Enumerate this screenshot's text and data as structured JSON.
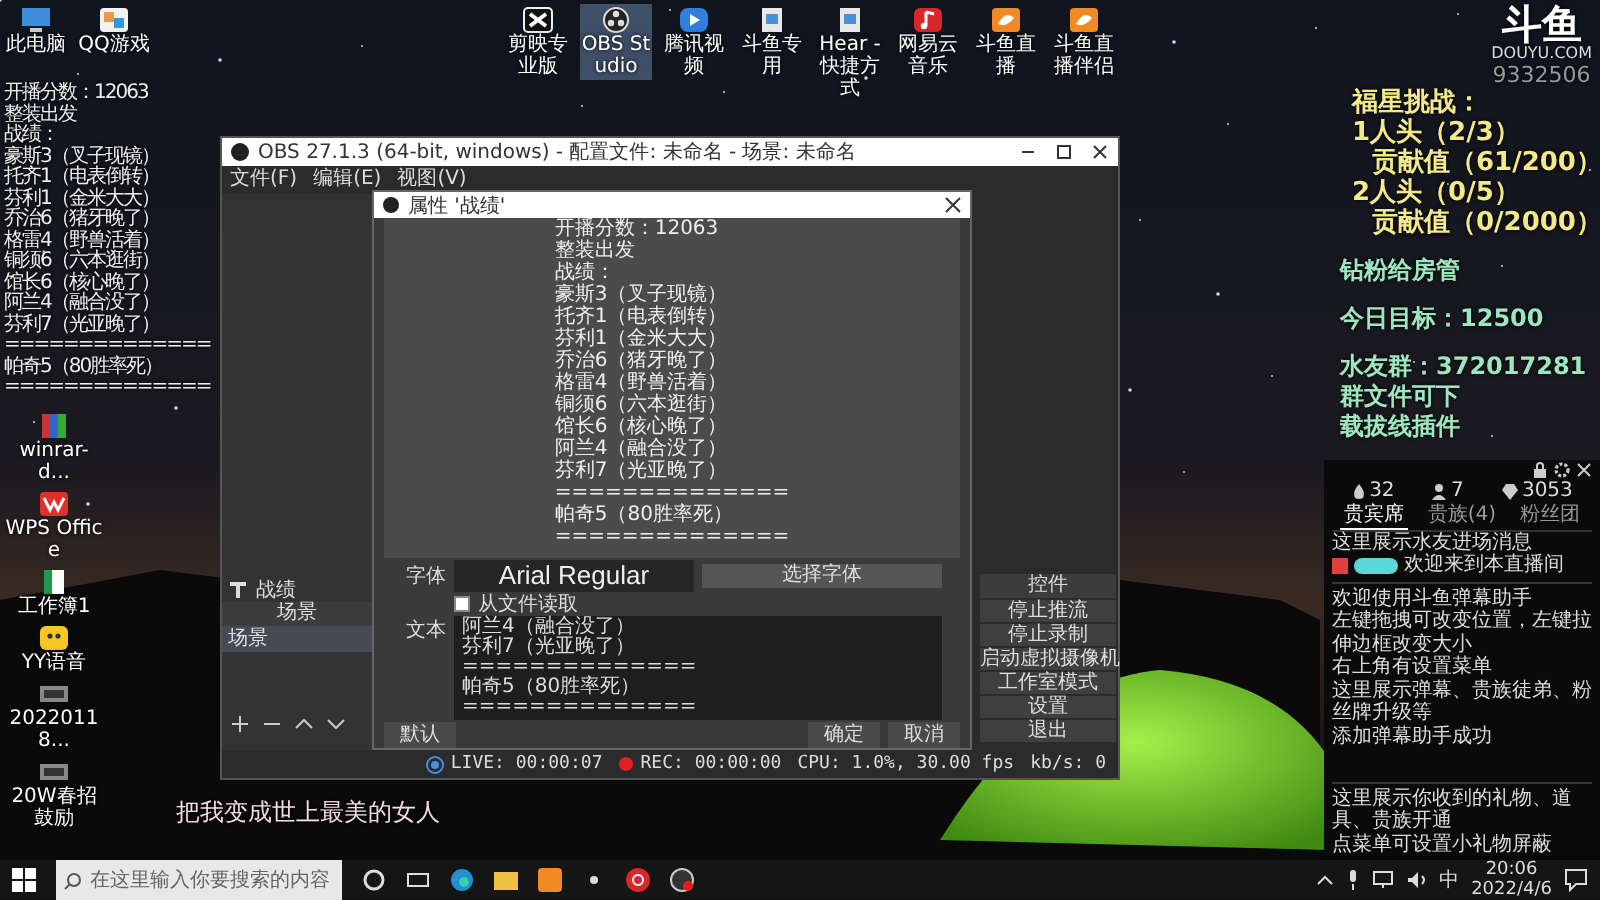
{
  "desktop": {
    "top_left_icons": [
      {
        "label": "此电脑",
        "kind": "computer",
        "selected": false
      },
      {
        "label": "QQ游戏",
        "kind": "game",
        "selected": false
      }
    ],
    "top_icons": [
      {
        "label": "剪映专业版",
        "kind": "editor",
        "selected": false
      },
      {
        "label": "OBS Studio",
        "kind": "obs",
        "selected": true
      },
      {
        "label": "腾讯视频",
        "kind": "video",
        "selected": false
      },
      {
        "label": "斗鱼专用",
        "kind": "shortcut",
        "selected": false
      },
      {
        "label": "Hear - 快捷方式",
        "kind": "shortcut",
        "selected": false
      },
      {
        "label": "网易云音乐",
        "kind": "music",
        "selected": false
      },
      {
        "label": "斗鱼直播",
        "kind": "fish",
        "selected": false
      },
      {
        "label": "斗鱼直播伴侣",
        "kind": "fish",
        "selected": false
      }
    ],
    "left_icons": [
      {
        "label": "winrar-d...",
        "kind": "archive",
        "selected": false
      },
      {
        "label": "WPS Office",
        "kind": "wps",
        "selected": false
      },
      {
        "label": "工作簿1",
        "kind": "sheet",
        "selected": false
      },
      {
        "label": "YY语音",
        "kind": "yy",
        "selected": false
      },
      {
        "label": "20220118...",
        "kind": "video-file",
        "selected": false
      },
      {
        "label": "20W春招鼓励",
        "kind": "video-file",
        "selected": false
      }
    ]
  },
  "overlay_left": {
    "lines": [
      "开播分数：12063",
      "整装出发",
      "战绩：",
      "豪斯3（叉子现镜）",
      "托齐1（电表倒转）",
      "芬利1（金米大大）",
      "乔治6（猪牙晚了）",
      "格雷4（野兽活着）",
      "铜须6（六本逛街）",
      "馆长6（核心晚了）",
      "阿兰4（融合没了）",
      "芬利7（光亚晚了）",
      "==============",
      "帕奇5（80胜率死）",
      "=============="
    ]
  },
  "overlay_right": {
    "logo": "斗鱼",
    "logo_caption": "DOUYU.COM",
    "room_id": "9332506",
    "challenge": [
      {
        "text": "福星挑战：",
        "kind": "head"
      },
      {
        "text": "1人头（2/3）",
        "kind": "head"
      },
      {
        "text": "贡献值（61/200）",
        "kind": "sub"
      },
      {
        "text": "2人头（0/5）",
        "kind": "head"
      },
      {
        "text": "贡献值（0/2000）",
        "kind": "sub"
      }
    ],
    "notes": [
      [
        "钻粉给房管"
      ],
      [
        "今日目标：12500"
      ],
      [
        "水友群：372017281",
        "群文件可下",
        "载拔线插件"
      ]
    ]
  },
  "obs": {
    "title": "OBS 27.1.3 (64-bit, windows) - 配置文件: 未命名 - 场景: 未命名",
    "menu": [
      "文件(F)",
      "编辑(E)",
      "视图(V)"
    ],
    "source": "战绩",
    "scenes_header": "场景",
    "scenes": [
      {
        "label": "场景",
        "selected": true
      }
    ],
    "controls_header": "控件",
    "controls": [
      "停止推流",
      "停止录制",
      "启动虚拟摄像机",
      "工作室模式",
      "设置",
      "退出"
    ],
    "status": {
      "live": "LIVE: 00:00:07",
      "rec": "REC: 00:00:00",
      "cpu": "CPU: 1.0%, 30.00 fps",
      "kbps": "kb/s: 0"
    }
  },
  "properties_dialog": {
    "title": "属性 '战绩'",
    "preview_lines": [
      "开播分数：12063",
      "整装出发",
      "战绩：",
      "豪斯3（叉子现镜）",
      "托齐1（电表倒转）",
      "芬利1（金米大大）",
      "乔治6（猪牙晚了）",
      "格雷4（野兽活着）",
      "铜须6（六本逛街）",
      "馆长6（核心晚了）",
      "阿兰4（融合没了）",
      "芬利7（光亚晚了）",
      "==============",
      "帕奇5（80胜率死）",
      "=============="
    ],
    "font_label": "字体",
    "font_value": "Arial Regular",
    "font_button": "选择字体",
    "read_from_file": {
      "label": "从文件读取",
      "checked": false
    },
    "text_label": "文本",
    "text_lines": [
      "阿兰4（融合没了）",
      "芬利7（光亚晚了）",
      "==============",
      "帕奇5（80胜率死）",
      "=============="
    ],
    "buttons": {
      "defaults": "默认",
      "ok": "确定",
      "cancel": "取消"
    }
  },
  "chat": {
    "stats": [
      "32",
      "7",
      "3053"
    ],
    "tabs": [
      {
        "label": "贵宾席",
        "selected": true
      },
      {
        "label": "贵族(4)",
        "selected": false
      },
      {
        "label": "粉丝团",
        "selected": false
      }
    ],
    "entry_notice": "这里展示水友进场消息",
    "welcome": "欢迎来到本直播间",
    "system_lines": [
      "欢迎使用斗鱼弹幕助手",
      "左键拖拽可改变位置，左键拉伸边框改变大小",
      "右上角有设置菜单",
      "这里展示弹幕、贵族徒弟、粉丝牌升级等",
      "添加弹幕助手成功"
    ],
    "gift_lines": [
      "这里展示你收到的礼物、道具、贵族开通",
      "点菜单可设置小礼物屏蔽"
    ]
  },
  "subtitle": "把我变成世上最美的女人",
  "taskbar": {
    "search_placeholder": "在这里输入你要搜索的内容",
    "ime": "中",
    "time": "20:06",
    "date": "2022/4/6"
  }
}
